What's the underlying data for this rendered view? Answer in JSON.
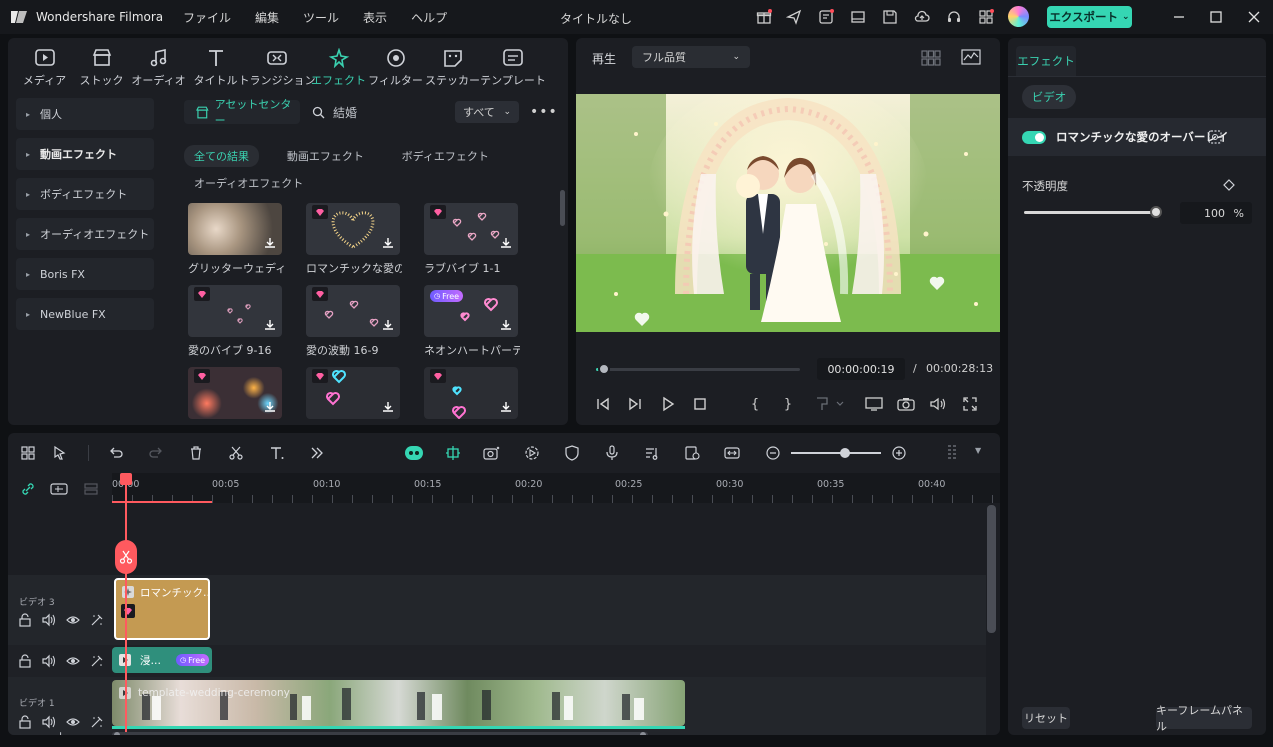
{
  "titlebar": {
    "app_title": "Wondershare Filmora",
    "menu": [
      "ファイル",
      "編集",
      "ツール",
      "表示",
      "ヘルプ"
    ],
    "doc_title": "タイトルなし",
    "export_label": "エクスポート"
  },
  "media": {
    "tabs": [
      "メディア",
      "ストック",
      "オーディオ",
      "タイトル",
      "トランジション",
      "エフェクト",
      "フィルター",
      "ステッカー",
      "テンプレート"
    ],
    "active_tab": "エフェクト",
    "sidebar": [
      "個人",
      "動画エフェクト",
      "ボディエフェクト",
      "オーディオエフェクト",
      "Boris FX",
      "NewBlue FX"
    ],
    "asset_center": "アセットセンター",
    "search_value": "結婚",
    "filter_dropdown": "すべて",
    "chips": [
      "全ての結果",
      "動画エフェクト",
      "ボディエフェクト"
    ],
    "chip_row2": "オーディオエフェクト",
    "thumbs": [
      {
        "caption": "グリッターウェディン…"
      },
      {
        "caption": "ロマンチックな愛の…"
      },
      {
        "caption": "ラブバイブ 1-1"
      },
      {
        "caption": "愛のバイブ 9-16"
      },
      {
        "caption": "愛の波動 16-9"
      },
      {
        "caption": "ネオンハートパーテ…"
      },
      {
        "caption": ""
      },
      {
        "caption": ""
      },
      {
        "caption": ""
      }
    ],
    "free_label": "Free"
  },
  "preview": {
    "label": "再生",
    "quality": "フル品質",
    "current_time": "00:00:00:19",
    "separator": "/",
    "total_time": "00:00:28:13"
  },
  "props": {
    "tab": "エフェクト",
    "sub_tab": "ビデオ",
    "effect_name": "ロマンチックな愛のオーバーレイ",
    "opacity_label": "不透明度",
    "opacity_value": "100",
    "opacity_unit": "%",
    "opacity_level": 1.0,
    "reset_label": "リセット",
    "keyframe_label": "キーフレームパネル"
  },
  "timeline": {
    "ruler": [
      "00:00",
      "00:05",
      "00:10",
      "00:15",
      "00:20",
      "00:25",
      "00:30",
      "00:35",
      "00:40"
    ],
    "tracks": {
      "video3_label": "ビデオ 3",
      "video1_label": "ビデオ 1"
    },
    "clips": {
      "effect_clip": "ロマンチック…",
      "overlay_clip": "浸…",
      "overlay_free": "Free",
      "video_clip": "template-wedding-ceremony"
    }
  },
  "colors": {
    "accent": "#35d6b3",
    "playhead": "#ff5a5f",
    "effect_clip": "#c49a52",
    "overlay_clip": "#2f8f7c"
  }
}
